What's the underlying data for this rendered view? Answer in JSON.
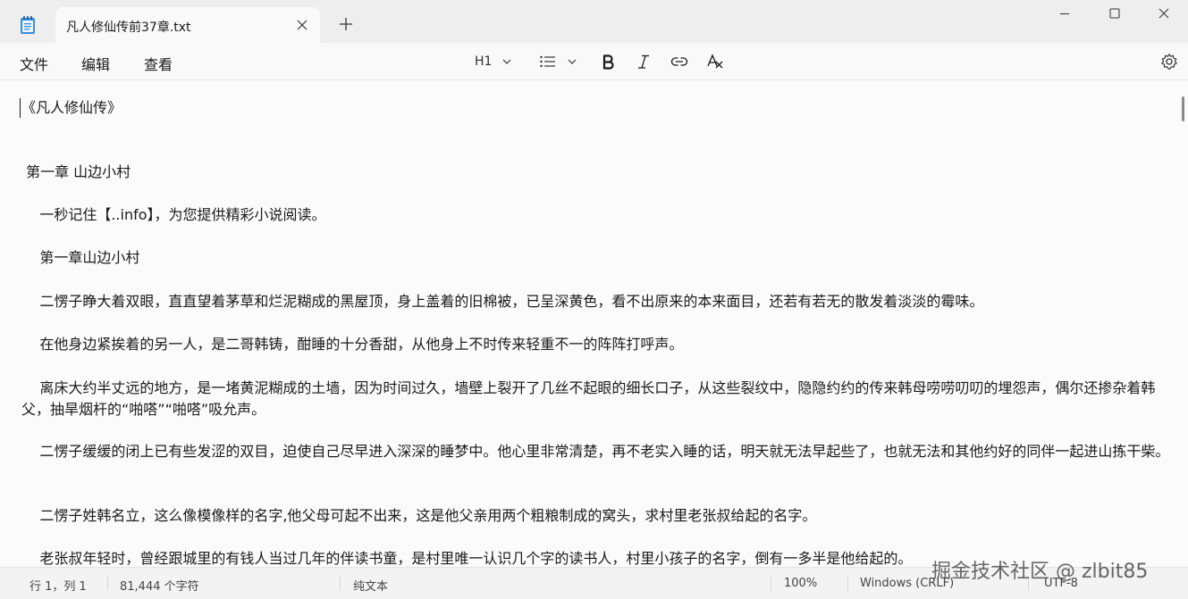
{
  "window": {
    "tab_title": "凡人修仙传前37章.txt",
    "app_icon": "notepad-icon",
    "controls": [
      "minimize-icon",
      "maximize-icon",
      "close-icon"
    ]
  },
  "menu": {
    "file": "文件",
    "edit": "编辑",
    "view": "查看"
  },
  "toolbar": {
    "heading": "H1",
    "list_icon": "bulleted-list-icon",
    "bold_icon": "bold-icon",
    "italic_icon": "italic-icon",
    "link_icon": "link-icon",
    "clear_format_icon": "clear-format-icon",
    "settings_icon": "gear-icon"
  },
  "document": {
    "lines": [
      "《凡人修仙传》",
      " 第一章 山边小村",
      "    一秒记住【..info】，为您提供精彩小说阅读。",
      "    第一章山边小村",
      "    二愣子睁大着双眼，直直望着茅草和烂泥糊成的黑屋顶，身上盖着的旧棉被，已呈深黄色，看不出原来的本来面目，还若有若无的散发着淡淡的霉味。",
      "    在他身边紧挨着的另一人，是二哥韩铸，酣睡的十分香甜，从他身上不时传来轻重不一的阵阵打呼声。",
      "    离床大约半丈远的地方，是一堵黄泥糊成的土墙，因为时间过久，墙壁上裂开了几丝不起眼的细长口子，从这些裂纹中，隐隐约约的传来韩母唠唠叨叨的埋怨声，偶尔还掺杂着韩父，抽旱烟杆的“啪嗒”“啪嗒”吸允声。",
      "    二愣子缓缓的闭上已有些发涩的双目，迫使自己尽早进入深深的睡梦中。他心里非常清楚，再不老实入睡的话，明天就无法早起些了，也就无法和其他约好的同伴一起进山拣干柴。",
      "    二愣子姓韩名立，这么像模像样的名字,他父母可起不出来，这是他父亲用两个粗粮制成的窝头，求村里老张叔给起的名字。",
      "    老张叔年轻时，曾经跟城里的有钱人当过几年的伴读书童，是村里唯一认识几个字的读书人，村里小孩子的名字，倒有一多半是他给起的。"
    ]
  },
  "status": {
    "position": "行 1，列 1",
    "char_count": "81,444 个字符",
    "format": "纯文本",
    "zoom": "100%",
    "line_ending": "Windows (CRLF)",
    "encoding": "UTF-8"
  },
  "watermark": "掘金技术社区 @ zlbit85"
}
